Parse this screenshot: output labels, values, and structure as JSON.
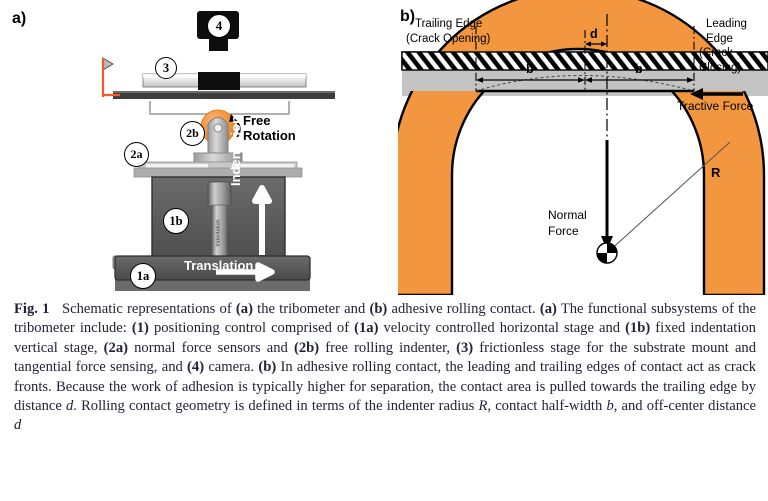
{
  "figure": {
    "panel_a_label": "a)",
    "panel_b_label": "b)"
  },
  "panel_a": {
    "name": "tribometer-schematic",
    "callouts": [
      {
        "id": "4",
        "label": "4",
        "meaning": "camera"
      },
      {
        "id": "3",
        "label": "3",
        "meaning": "frictionless-stage"
      },
      {
        "id": "2b",
        "label": "2b",
        "meaning": "free-rolling-indenter"
      },
      {
        "id": "2a",
        "label": "2a",
        "meaning": "normal-force-sensors"
      },
      {
        "id": "1b",
        "label": "1b",
        "meaning": "fixed-indentation-vertical-stage"
      },
      {
        "id": "1a",
        "label": "1a",
        "meaning": "velocity-controlled-horizontal-stage"
      }
    ],
    "annotations": {
      "free_rotation_line1": "Free",
      "free_rotation_line2": "Rotation",
      "indentation": "Indentation",
      "translation": "Translation",
      "indenter_body_text": "Indentation"
    },
    "colors": {
      "dark_gray_stage": "#575757",
      "mid_gray": "#aaaaaa",
      "light_gray": "#d9d9d9",
      "orange": "#f2973f",
      "black": "#000000",
      "accent_orange_line": "#f15a24"
    }
  },
  "panel_b": {
    "name": "adhesive-rolling-contact-schematic",
    "labels": {
      "trailing_edge_line1": "Trailing Edge",
      "trailing_edge_line2": "(Crack Opening)",
      "leading_edge_line1": "Leading Edge",
      "leading_edge_line2": "(Crack Closing)",
      "offset_distance": "d",
      "half_width_left": "b",
      "half_width_right": "b",
      "radius": "R",
      "tractive_force": "Tractive Force",
      "normal_force_line1": "Normal",
      "normal_force_line2": "Force"
    },
    "colors": {
      "indenter_fill": "#f2973f",
      "substrate_gray": "#c3c3c3",
      "hatch_black": "#000000",
      "outline": "#000000"
    }
  },
  "caption": {
    "prefix": "Fig. 1",
    "segments": [
      {
        "t": "Schematic representations of ",
        "b": false
      },
      {
        "t": "(a)",
        "b": true
      },
      {
        "t": " the tribometer and ",
        "b": false
      },
      {
        "t": "(b)",
        "b": true
      },
      {
        "t": " adhesive rolling contact. ",
        "b": false
      },
      {
        "t": "(a)",
        "b": true
      },
      {
        "t": " The functional subsystems of the tribometer include: ",
        "b": false
      },
      {
        "t": "(1)",
        "b": true
      },
      {
        "t": " positioning control comprised of ",
        "b": false
      },
      {
        "t": "(1a)",
        "b": true
      },
      {
        "t": " velocity controlled horizontal stage and ",
        "b": false
      },
      {
        "t": "(1b)",
        "b": true
      },
      {
        "t": " fixed indentation vertical stage, ",
        "b": false
      },
      {
        "t": "(2a)",
        "b": true
      },
      {
        "t": " normal force sensors and ",
        "b": false
      },
      {
        "t": "(2b)",
        "b": true
      },
      {
        "t": " free rolling indenter, ",
        "b": false
      },
      {
        "t": "(3)",
        "b": true
      },
      {
        "t": " frictionless stage for the substrate mount and tangential force sensing, and ",
        "b": false
      },
      {
        "t": "(4)",
        "b": true
      },
      {
        "t": " camera. ",
        "b": false
      },
      {
        "t": "(b)",
        "b": true
      },
      {
        "t": " In adhesive rolling contact, the leading and trailing edges of contact act as crack fronts. Because the work of adhesion is typically higher for separation, the contact area is pulled towards the trailing edge by distance ",
        "b": false
      },
      {
        "t": "d",
        "b": false,
        "i": true
      },
      {
        "t": ". Rolling contact geometry is defined in terms of the indenter radius ",
        "b": false
      },
      {
        "t": "R",
        "b": false,
        "i": true
      },
      {
        "t": ", contact half-width ",
        "b": false
      },
      {
        "t": "b",
        "b": false,
        "i": true
      },
      {
        "t": ", and off-center distance ",
        "b": false
      },
      {
        "t": "d",
        "b": false,
        "i": true
      }
    ]
  }
}
